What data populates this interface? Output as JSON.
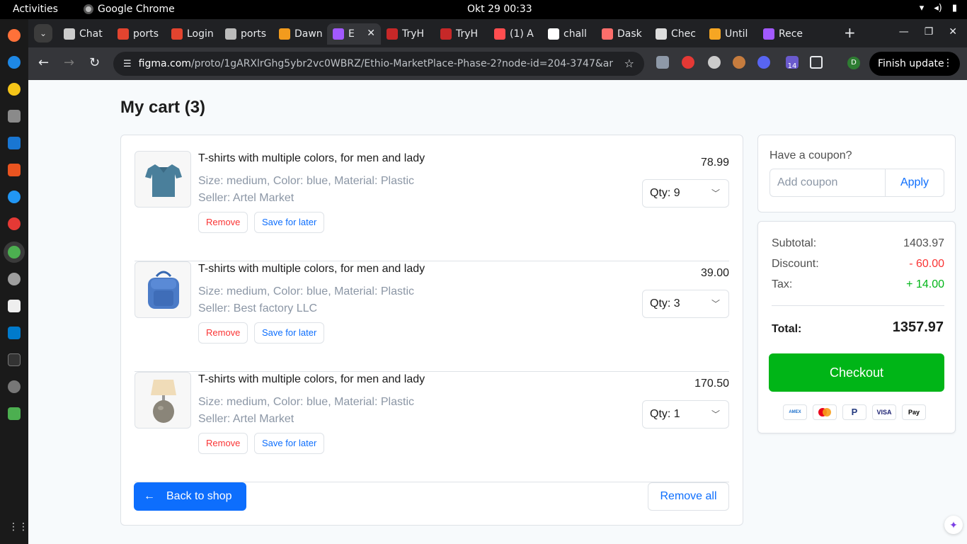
{
  "system": {
    "activities": "Activities",
    "app_name": "Google Chrome",
    "clock": "Okt 29  00:33"
  },
  "browser": {
    "tabs": [
      {
        "label": "Chat",
        "icon": "openai-icon",
        "color": "#cccccc"
      },
      {
        "label": "ports",
        "icon": "bolt-icon",
        "color": "#e2442f"
      },
      {
        "label": "Login",
        "icon": "bolt-icon",
        "color": "#e2442f"
      },
      {
        "label": "ports",
        "icon": "bolt-icon",
        "color": "#bbbbbb"
      },
      {
        "label": "Dawn",
        "icon": "sun-icon",
        "color": "#f29b1d"
      },
      {
        "label": "E",
        "icon": "figma-icon",
        "color": "#a259ff"
      },
      {
        "label": "TryH",
        "icon": "cloud-icon",
        "color": "#c62828"
      },
      {
        "label": "TryH",
        "icon": "cloud-icon",
        "color": "#c62828"
      },
      {
        "label": "(1) A",
        "icon": "tiktok-icon",
        "color": "#ff4d4f"
      },
      {
        "label": "chall",
        "icon": "github-icon",
        "color": "#ffffff"
      },
      {
        "label": "Dask",
        "icon": "dask-icon",
        "color": "#fc6e6b"
      },
      {
        "label": "Chec",
        "icon": "chart-icon",
        "color": "#dddddd"
      },
      {
        "label": "Until",
        "icon": "infinity-icon",
        "color": "#f6a623"
      },
      {
        "label": "Rece",
        "icon": "figma-icon",
        "color": "#a259ff"
      }
    ],
    "active_tab": 5,
    "url_host": "figma.com",
    "url_path": "/proto/1gARXlrGhg5ybr2vc0WBRZ/Ethio-MarketPlace-Phase-2?node-id=204-3747&amp%3Bt...",
    "extension_badge": "14",
    "profile_initial": "D",
    "finish_update": "Finish update"
  },
  "page": {
    "title": "My cart (3)",
    "items": [
      {
        "title": "T-shirts with multiple colors, for men and lady",
        "meta": "Size: medium, Color: blue,  Material: Plastic",
        "seller": "Seller: Artel Market",
        "price": "78.99",
        "qty": "Qty: 9",
        "remove": "Remove",
        "save": "Save for later"
      },
      {
        "title": "T-shirts with multiple colors, for men and lady",
        "meta": "Size: medium, Color: blue,  Material: Plastic",
        "seller": "Seller: Best factory LLC",
        "price": "39.00",
        "qty": "Qty: 3",
        "remove": "Remove",
        "save": "Save for later"
      },
      {
        "title": "T-shirts with multiple colors, for men and lady",
        "meta": "Size: medium, Color: blue,  Material: Plastic",
        "seller": "Seller: Artel Market",
        "price": "170.50",
        "qty": "Qty: 1",
        "remove": "Remove",
        "save": "Save for later"
      }
    ],
    "back_to_shop": "Back to shop",
    "remove_all": "Remove all",
    "coupon": {
      "label": "Have a coupon?",
      "placeholder": "Add coupon",
      "apply": "Apply"
    },
    "summary": {
      "subtotal_label": "Subtotal:",
      "subtotal": "1403.97",
      "discount_label": "Discount:",
      "discount": "- 60.00",
      "tax_label": "Tax:",
      "tax": "+ 14.00",
      "total_label": "Total:",
      "total": "1357.97",
      "checkout": "Checkout"
    },
    "payment_methods": [
      "AMEX",
      "mastercard",
      "PayPal",
      "VISA",
      "Pay"
    ],
    "colors": {
      "primary": "#0d6efd",
      "success": "#00b517",
      "danger": "#fa3434"
    }
  }
}
